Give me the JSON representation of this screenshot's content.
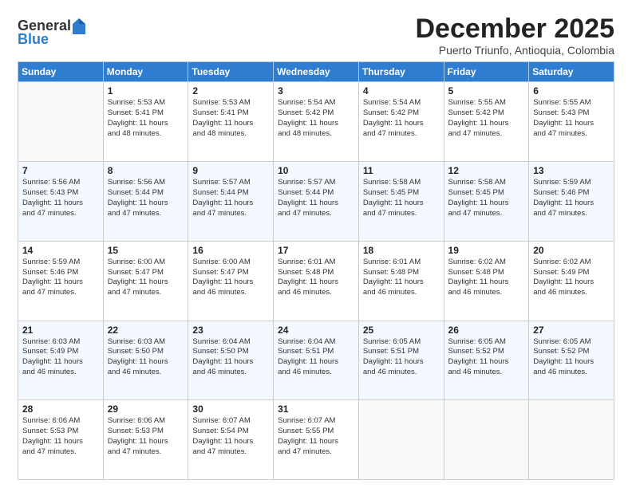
{
  "header": {
    "logo_general": "General",
    "logo_blue": "Blue",
    "month_title": "December 2025",
    "subtitle": "Puerto Triunfo, Antioquia, Colombia"
  },
  "days_of_week": [
    "Sunday",
    "Monday",
    "Tuesday",
    "Wednesday",
    "Thursday",
    "Friday",
    "Saturday"
  ],
  "weeks": [
    [
      {
        "day": "",
        "info": ""
      },
      {
        "day": "1",
        "info": "Sunrise: 5:53 AM\nSunset: 5:41 PM\nDaylight: 11 hours\nand 48 minutes."
      },
      {
        "day": "2",
        "info": "Sunrise: 5:53 AM\nSunset: 5:41 PM\nDaylight: 11 hours\nand 48 minutes."
      },
      {
        "day": "3",
        "info": "Sunrise: 5:54 AM\nSunset: 5:42 PM\nDaylight: 11 hours\nand 48 minutes."
      },
      {
        "day": "4",
        "info": "Sunrise: 5:54 AM\nSunset: 5:42 PM\nDaylight: 11 hours\nand 47 minutes."
      },
      {
        "day": "5",
        "info": "Sunrise: 5:55 AM\nSunset: 5:42 PM\nDaylight: 11 hours\nand 47 minutes."
      },
      {
        "day": "6",
        "info": "Sunrise: 5:55 AM\nSunset: 5:43 PM\nDaylight: 11 hours\nand 47 minutes."
      }
    ],
    [
      {
        "day": "7",
        "info": "Sunrise: 5:56 AM\nSunset: 5:43 PM\nDaylight: 11 hours\nand 47 minutes."
      },
      {
        "day": "8",
        "info": "Sunrise: 5:56 AM\nSunset: 5:44 PM\nDaylight: 11 hours\nand 47 minutes."
      },
      {
        "day": "9",
        "info": "Sunrise: 5:57 AM\nSunset: 5:44 PM\nDaylight: 11 hours\nand 47 minutes."
      },
      {
        "day": "10",
        "info": "Sunrise: 5:57 AM\nSunset: 5:44 PM\nDaylight: 11 hours\nand 47 minutes."
      },
      {
        "day": "11",
        "info": "Sunrise: 5:58 AM\nSunset: 5:45 PM\nDaylight: 11 hours\nand 47 minutes."
      },
      {
        "day": "12",
        "info": "Sunrise: 5:58 AM\nSunset: 5:45 PM\nDaylight: 11 hours\nand 47 minutes."
      },
      {
        "day": "13",
        "info": "Sunrise: 5:59 AM\nSunset: 5:46 PM\nDaylight: 11 hours\nand 47 minutes."
      }
    ],
    [
      {
        "day": "14",
        "info": "Sunrise: 5:59 AM\nSunset: 5:46 PM\nDaylight: 11 hours\nand 47 minutes."
      },
      {
        "day": "15",
        "info": "Sunrise: 6:00 AM\nSunset: 5:47 PM\nDaylight: 11 hours\nand 47 minutes."
      },
      {
        "day": "16",
        "info": "Sunrise: 6:00 AM\nSunset: 5:47 PM\nDaylight: 11 hours\nand 46 minutes."
      },
      {
        "day": "17",
        "info": "Sunrise: 6:01 AM\nSunset: 5:48 PM\nDaylight: 11 hours\nand 46 minutes."
      },
      {
        "day": "18",
        "info": "Sunrise: 6:01 AM\nSunset: 5:48 PM\nDaylight: 11 hours\nand 46 minutes."
      },
      {
        "day": "19",
        "info": "Sunrise: 6:02 AM\nSunset: 5:48 PM\nDaylight: 11 hours\nand 46 minutes."
      },
      {
        "day": "20",
        "info": "Sunrise: 6:02 AM\nSunset: 5:49 PM\nDaylight: 11 hours\nand 46 minutes."
      }
    ],
    [
      {
        "day": "21",
        "info": "Sunrise: 6:03 AM\nSunset: 5:49 PM\nDaylight: 11 hours\nand 46 minutes."
      },
      {
        "day": "22",
        "info": "Sunrise: 6:03 AM\nSunset: 5:50 PM\nDaylight: 11 hours\nand 46 minutes."
      },
      {
        "day": "23",
        "info": "Sunrise: 6:04 AM\nSunset: 5:50 PM\nDaylight: 11 hours\nand 46 minutes."
      },
      {
        "day": "24",
        "info": "Sunrise: 6:04 AM\nSunset: 5:51 PM\nDaylight: 11 hours\nand 46 minutes."
      },
      {
        "day": "25",
        "info": "Sunrise: 6:05 AM\nSunset: 5:51 PM\nDaylight: 11 hours\nand 46 minutes."
      },
      {
        "day": "26",
        "info": "Sunrise: 6:05 AM\nSunset: 5:52 PM\nDaylight: 11 hours\nand 46 minutes."
      },
      {
        "day": "27",
        "info": "Sunrise: 6:05 AM\nSunset: 5:52 PM\nDaylight: 11 hours\nand 46 minutes."
      }
    ],
    [
      {
        "day": "28",
        "info": "Sunrise: 6:06 AM\nSunset: 5:53 PM\nDaylight: 11 hours\nand 47 minutes."
      },
      {
        "day": "29",
        "info": "Sunrise: 6:06 AM\nSunset: 5:53 PM\nDaylight: 11 hours\nand 47 minutes."
      },
      {
        "day": "30",
        "info": "Sunrise: 6:07 AM\nSunset: 5:54 PM\nDaylight: 11 hours\nand 47 minutes."
      },
      {
        "day": "31",
        "info": "Sunrise: 6:07 AM\nSunset: 5:55 PM\nDaylight: 11 hours\nand 47 minutes."
      },
      {
        "day": "",
        "info": ""
      },
      {
        "day": "",
        "info": ""
      },
      {
        "day": "",
        "info": ""
      }
    ]
  ]
}
